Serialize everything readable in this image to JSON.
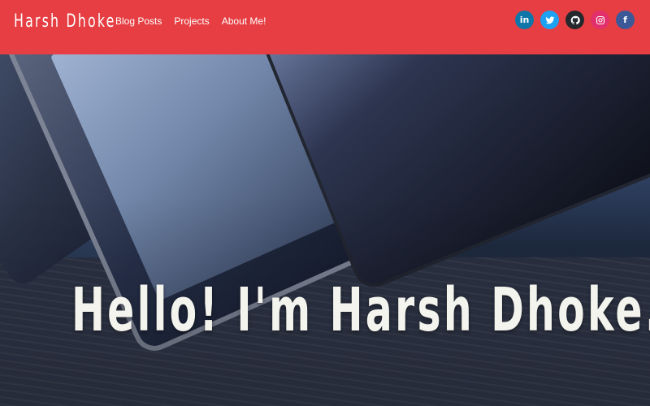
{
  "navbar": {
    "brand": "Harsh Dhoke",
    "links": [
      {
        "label": "Blog Posts"
      },
      {
        "label": "Projects"
      },
      {
        "label": "About Me!"
      }
    ],
    "socials": [
      {
        "name": "linkedin-icon",
        "glyph": "in",
        "color": "#0e76a8"
      },
      {
        "name": "twitter-icon",
        "glyph": "",
        "color": "#1da1f2"
      },
      {
        "name": "github-icon",
        "glyph": "",
        "color": "#24292e"
      },
      {
        "name": "instagram-icon",
        "glyph": "",
        "color": "#e1306c"
      },
      {
        "name": "facebook-icon",
        "glyph": "f",
        "color": "#3b5998"
      }
    ],
    "background_color": "#e63e42"
  },
  "hero": {
    "headline": "Hello! I'm Harsh Dhoke."
  }
}
